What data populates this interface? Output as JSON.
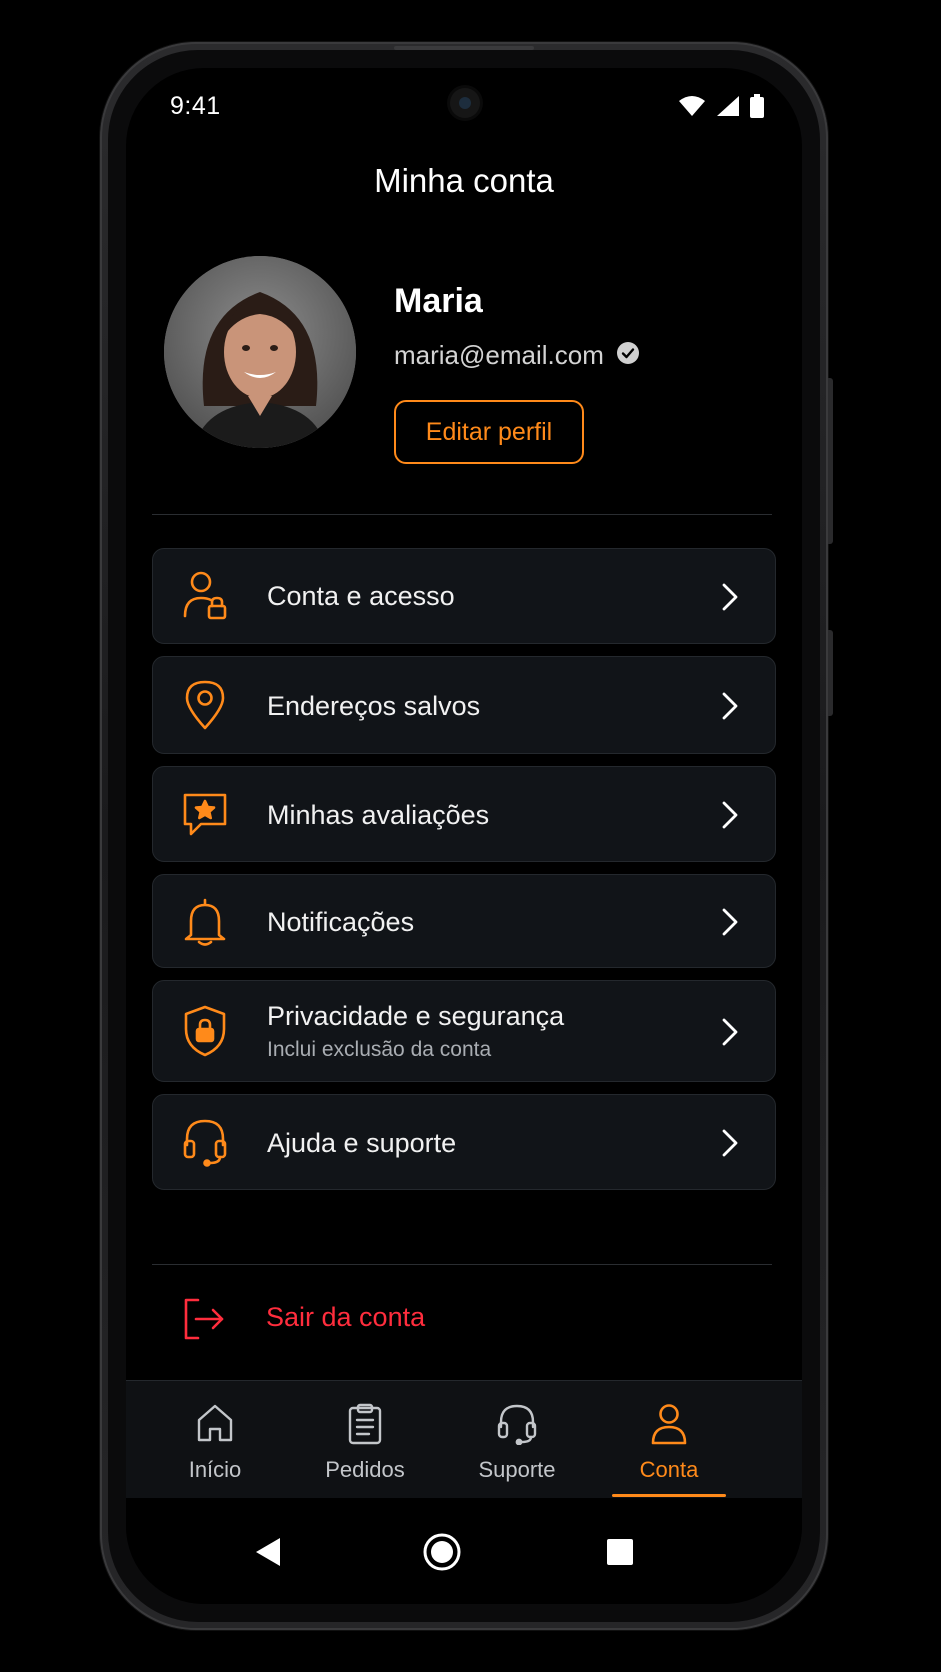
{
  "status_bar": {
    "time": "9:41",
    "icons": [
      "wifi-icon",
      "signal-icon",
      "battery-icon"
    ]
  },
  "header": {
    "title": "Minha conta"
  },
  "profile": {
    "name": "Maria",
    "email": "maria@email.com",
    "verified_icon": "check-circle-icon",
    "edit_button": "Editar perfil"
  },
  "menu": {
    "items": [
      {
        "label": "Conta e acesso",
        "icon": "user-lock-icon"
      },
      {
        "label": "Endereços salvos",
        "icon": "map-pin-icon"
      },
      {
        "label": "Minhas avaliações",
        "icon": "star-chat-icon"
      },
      {
        "label": "Notificações",
        "icon": "bell-icon"
      },
      {
        "label": "Privacidade e segurança",
        "sublabel": "Inclui exclusão da conta",
        "icon": "shield-lock-icon"
      },
      {
        "label": "Ajuda e suporte",
        "icon": "headset-icon"
      }
    ]
  },
  "logout": {
    "label": "Sair da conta",
    "icon": "logout-icon"
  },
  "tabbar": {
    "tabs": [
      {
        "label": "Início",
        "icon": "home-icon"
      },
      {
        "label": "Pedidos",
        "icon": "clipboard-icon"
      },
      {
        "label": "Suporte",
        "icon": "headset-icon"
      },
      {
        "label": "Conta",
        "icon": "user-icon"
      }
    ],
    "active": "Conta"
  },
  "colors": {
    "accent": "#ff8a1a",
    "danger": "#ff2d3d",
    "background": "#000000",
    "card": "#111418"
  }
}
